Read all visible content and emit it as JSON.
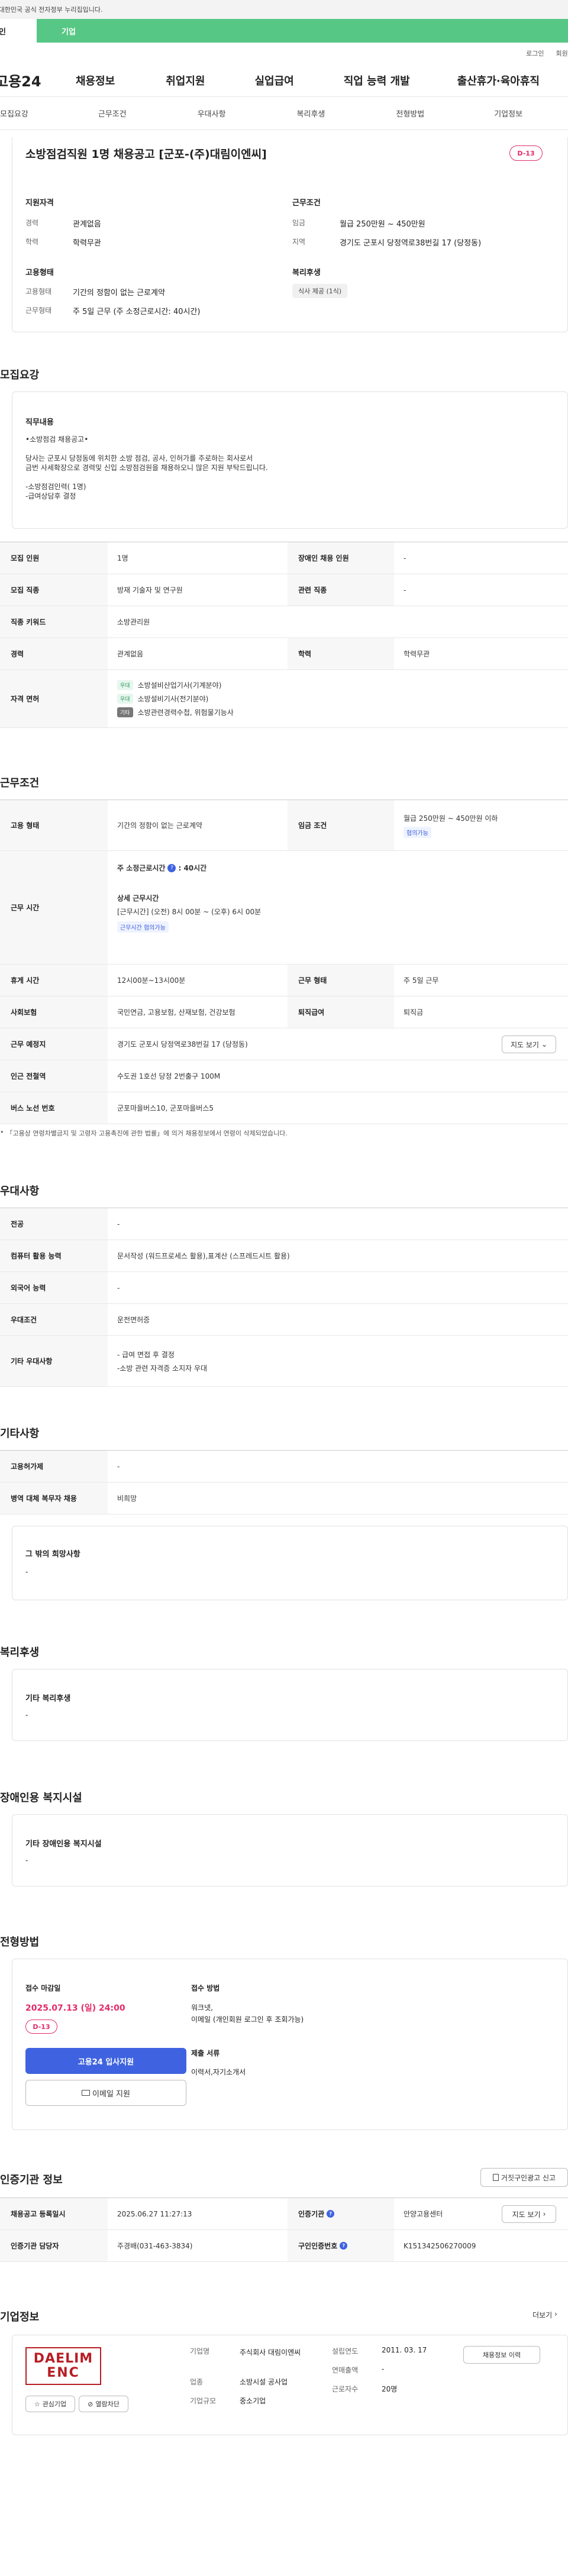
{
  "gov_notice": "이 누리집은 대한민국 공식 전자정부 누리집입니다.",
  "top_tabs": [
    "개인",
    "기업"
  ],
  "util_links": [
    "로그인",
    "회원가입"
  ],
  "logo": "고용24",
  "gnb": [
    "채용정보",
    "취업지원",
    "실업급여",
    "직업 능력 개발",
    "출산휴가·육아휴직"
  ],
  "anchors": [
    "모집요강",
    "근무조건",
    "우대사항",
    "복리후생",
    "전형방법",
    "기업정보"
  ],
  "summary": {
    "title": "소방점검직원 1명 채용공고 [군포-(주)대림이엔씨]",
    "dday": "D-13",
    "qual_heading": "지원자격",
    "qual": [
      {
        "k": "경력",
        "v": "관계없음"
      },
      {
        "k": "학력",
        "v": "학력무관"
      }
    ],
    "cond_heading": "근무조건",
    "cond": [
      {
        "k": "임금",
        "v": "월급 250만원 ~ 450만원"
      },
      {
        "k": "지역",
        "v": "경기도 군포시 당정역로38번길 17 (당정동)"
      }
    ],
    "type_heading": "고용형태",
    "type": [
      {
        "k": "고용형태",
        "v": "기간의 정함이 없는 근로계약"
      },
      {
        "k": "근무형태",
        "v": "주 5일 근무 (주 소정근로시간: 40시간)"
      }
    ],
    "welfare_heading": "복리후생",
    "welfare_chip": "식사 제공 (1식)"
  },
  "recruit": {
    "title": "모집요강",
    "duty_label": "직무내용",
    "duty_lines": [
      "•소방점검 채용공고•",
      "",
      "당사는 군포시 당정동에 위치한 소방 점검, 공사, 인허가를 주로하는 회사로서",
      "금번 사세확장으로  경력및 신입 소방점검원을 채용하오니  많은 지원 부탁드립니다.",
      "",
      "-소방점검인력( 1명)",
      "-급여상담후 결정"
    ],
    "rows": [
      {
        "k": "모집 인원",
        "v": "1명",
        "k2": "장애인 채용 인원",
        "v2": "-"
      },
      {
        "k": "모집 직종",
        "v": "방재 기술자 및 연구원",
        "k2": "관련 직종",
        "v2": "-"
      },
      {
        "k": "직종 키워드",
        "v": "소방관리원"
      },
      {
        "k": "경력",
        "v": "관계없음",
        "k2": "학력",
        "v2": "학력무관"
      }
    ],
    "license_label": "자격 면허",
    "licenses": [
      {
        "tag": "우대",
        "name": "소방설비산업기사(기계분야)"
      },
      {
        "tag": "우대",
        "name": "소방설비기사(전기분야)"
      },
      {
        "tag": "기타",
        "name": "소방관련경력수첩, 위험물기능사"
      }
    ]
  },
  "work": {
    "title": "근무조건",
    "emp_type_k": "고용 형태",
    "emp_type_v": "기간의 정함이 없는 근로계약",
    "wage_k": "임금 조건",
    "wage_v": "월급 250만원 ~ 450만원 이하",
    "wage_chip": "협의가능",
    "hours_k": "근무 시간",
    "hours_main": "주 소정근로시간",
    "hours_val": ": 40시간",
    "hours_detail_label": "상세 근무시간",
    "hours_detail": "[근무시간] (오전) 8시 00분 ~ (오후) 6시 00분",
    "hours_chip": "근무시간 협의가능",
    "rest_k": "휴게 시간",
    "rest_v": "12시00분~13시00분",
    "form_k": "근무 형태",
    "form_v": "주 5일 근무",
    "ins_k": "사회보험",
    "ins_v": "국민연금, 고용보험, 산재보험, 건강보험",
    "ret_k": "퇴직급여",
    "ret_v": "퇴직금",
    "place_k": "근무 예정지",
    "place_v": "경기도 군포시 당정역로38번길 17 (당정동)",
    "map_btn": "지도 보기",
    "subway_k": "인근 전철역",
    "subway_v": "수도권 1호선 당정 2번출구 100M",
    "bus_k": "버스 노선 번호",
    "bus_v": "군포마을버스10, 군포마을버스5",
    "note": "「고용상 연령차별금지 및 고령자 고용촉진에 관한 법률」에 의거 채용정보에서 연령이 삭제되었습니다."
  },
  "pref": {
    "title": "우대사항",
    "rows": [
      {
        "k": "전공",
        "v": "-"
      },
      {
        "k": "컴퓨터 활용 능력",
        "v": "문서작성 (워드프로세스 활용),표계산 (스프레드시트 활용)"
      },
      {
        "k": "외국어 능력",
        "v": "-"
      },
      {
        "k": "우대조건",
        "v": "운전면허증"
      }
    ],
    "etc_k": "기타 우대사항",
    "etc_lines": [
      "- 급여 면접 후 결정",
      " -소방 관련 자격증 소지자 우대"
    ]
  },
  "other": {
    "title": "기타사항",
    "rows": [
      {
        "k": "고용허가제",
        "v": "-"
      },
      {
        "k": "병역 대체 복무자 채용",
        "v": "비희망"
      }
    ],
    "wish_label": "그 밖의 희망사항",
    "wish_v": "-"
  },
  "benefit": {
    "title": "복리후생",
    "label": "기타 복리후생",
    "v": "-"
  },
  "disabled": {
    "title": "장애인용 복지시설",
    "label": "기타 장애인용 복지시설",
    "v": "-"
  },
  "selection": {
    "title": "전형방법",
    "deadline_label": "접수 마감일",
    "deadline": "2025.07.13 (일) 24:00",
    "dday": "D-13",
    "apply_btn": "고용24 입사지원",
    "email_btn": "이메일 지원",
    "method_label": "접수 방법",
    "method_lines": [
      "워크넷,",
      "이메일 (개인회원 로그인 후 조회가능)"
    ],
    "docs_label": "제출 서류",
    "docs_v": "이력서,자기소개서"
  },
  "cert": {
    "title": "인증기관 정보",
    "report_btn": "거짓구인광고 신고",
    "rows": [
      {
        "k": "채용공고 등록일시",
        "v": "2025.06.27 11:27:13",
        "k2": "인증기관",
        "v2": "안양고용센터",
        "btn": "지도 보기"
      },
      {
        "k": "인증기관 담당자",
        "v": "주경배(031-463-3834)",
        "k2": "구인인증번호",
        "v2": "K151342506270009"
      }
    ]
  },
  "company": {
    "title": "기업정보",
    "more": "더보기",
    "logo_top": "DAELIM",
    "logo_bottom": "ENC",
    "fav_btn": "관심기업",
    "block_btn": "열람차단",
    "fields": [
      {
        "k": "기업명",
        "v": "주식회사 대림이엔씨"
      },
      {
        "k": "업종",
        "v": "소방시설 공사업"
      },
      {
        "k": "기업규모",
        "v": "중소기업"
      }
    ],
    "fields2": [
      {
        "k": "설립연도",
        "v": "2011. 03. 17"
      },
      {
        "k": "연매출액",
        "v": "-"
      },
      {
        "k": "근로자수",
        "v": "20명"
      }
    ],
    "jobs_btn": "채용정보 이력"
  },
  "colors": {
    "accent": "#3f63e0",
    "green": "#57c785",
    "dday": "#e32a6b",
    "deadline": "#e32a6b"
  }
}
